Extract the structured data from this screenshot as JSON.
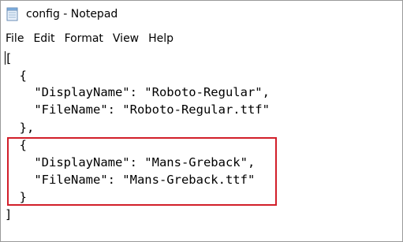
{
  "window": {
    "title": "config - Notepad",
    "icon": "notepad-icon"
  },
  "menu": {
    "items": [
      "File",
      "Edit",
      "Format",
      "View",
      "Help"
    ]
  },
  "editor": {
    "lines": [
      "[",
      "  {",
      "    \"DisplayName\": \"Roboto-Regular\",",
      "    \"FileName\": \"Roboto-Regular.ttf\"",
      "  },",
      "  {",
      "    \"DisplayName\": \"Mans-Greback\",",
      "    \"FileName\": \"Mans-Greback.ttf\"",
      "  }",
      "]"
    ],
    "highlight_color": "#d21f2a"
  }
}
